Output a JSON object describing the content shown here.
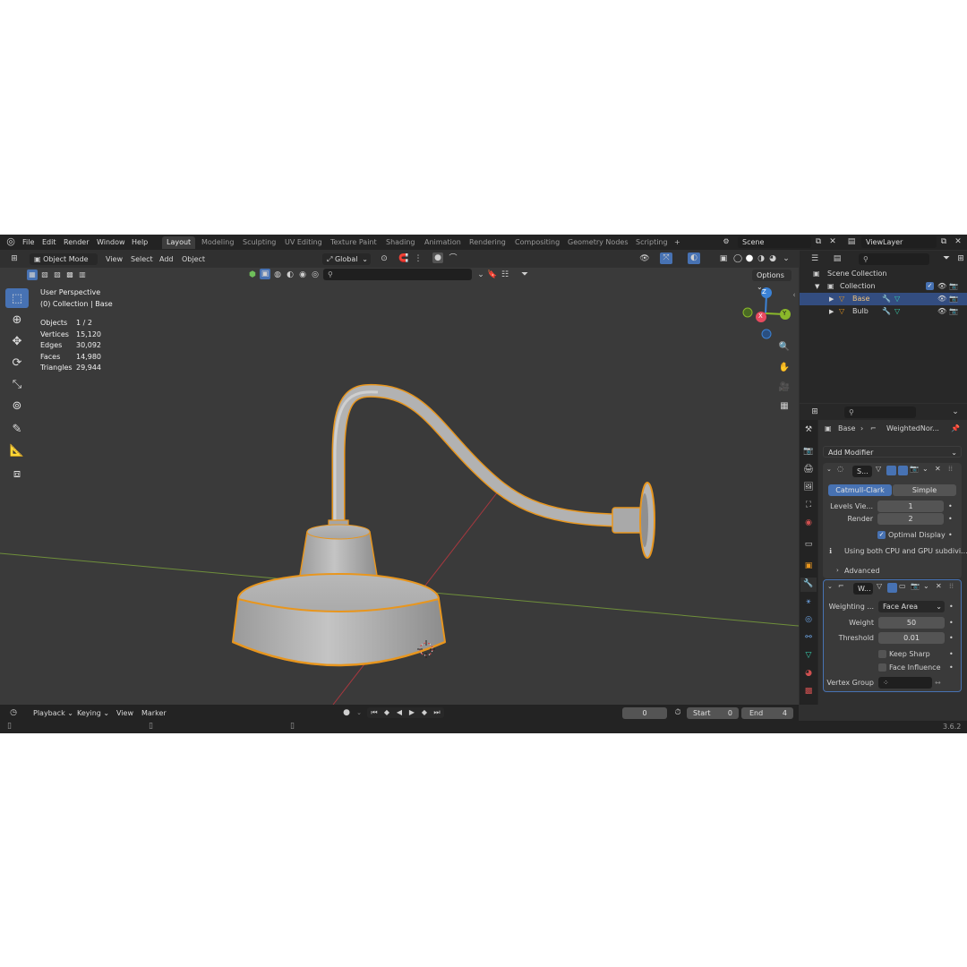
{
  "topbar": {
    "menus": [
      "File",
      "Edit",
      "Render",
      "Window",
      "Help"
    ],
    "workspace_tabs": [
      "Layout",
      "Modeling",
      "Sculpting",
      "UV Editing",
      "Texture Paint",
      "Shading",
      "Animation",
      "Rendering",
      "Compositing",
      "Geometry Nodes",
      "Scripting"
    ],
    "active_tab": "Layout",
    "add_tab": "+",
    "scene": "Scene",
    "view_layer": "ViewLayer"
  },
  "viewport_header": {
    "mode": "Object Mode",
    "menus": [
      "View",
      "Select",
      "Add",
      "Object"
    ],
    "transform_orientation": "Global",
    "options_label": "Options"
  },
  "viewport": {
    "view_name": "User Perspective",
    "collection_info": "(0) Collection | Base",
    "stats": [
      {
        "label": "Objects",
        "value": "1 / 2"
      },
      {
        "label": "Vertices",
        "value": "15,120"
      },
      {
        "label": "Edges",
        "value": "30,092"
      },
      {
        "label": "Faces",
        "value": "14,980"
      },
      {
        "label": "Triangles",
        "value": "29,944"
      }
    ],
    "gizmo_axes": {
      "x": "X",
      "y": "Y",
      "z": "Z"
    },
    "tools": [
      "select-box-tool",
      "cursor-tool",
      "move-tool",
      "rotate-tool",
      "scale-tool",
      "transform-tool",
      "annotate-tool",
      "measure-tool",
      "add-cube-tool"
    ]
  },
  "outliner": {
    "root": "Scene Collection",
    "collection": "Collection",
    "items": [
      {
        "name": "Base",
        "selected": true
      },
      {
        "name": "Bulb",
        "selected": false
      }
    ]
  },
  "properties": {
    "breadcrumb_object": "Base",
    "breadcrumb_modifier": "WeightedNor...",
    "add_modifier": "Add Modifier",
    "subsurf": {
      "name": "S...",
      "tabs": [
        "Catmull-Clark",
        "Simple"
      ],
      "active_tab": "Catmull-Clark",
      "levels_viewport_label": "Levels Vie...",
      "levels_viewport": "1",
      "render_label": "Render",
      "render": "2",
      "optimal_display_label": "Optimal Display",
      "optimal_display": true,
      "info": "Using both CPU and GPU subdivi...",
      "advanced_label": "Advanced"
    },
    "weighted_normal": {
      "name": "W...",
      "weighting_label": "Weighting ...",
      "weighting": "Face Area",
      "weight_label": "Weight",
      "weight": "50",
      "threshold_label": "Threshold",
      "threshold": "0.01",
      "keep_sharp_label": "Keep Sharp",
      "keep_sharp": false,
      "face_influence_label": "Face Influence",
      "face_influence": false,
      "vertex_group_label": "Vertex Group"
    }
  },
  "timeline": {
    "menus": [
      "Playback",
      "Keying",
      "View",
      "Marker"
    ],
    "current_frame": "0",
    "start_label": "Start",
    "start": "0",
    "end_label": "End",
    "end": "4"
  },
  "status": {
    "version": "3.6.2"
  },
  "colors": {
    "accent": "#4772b3",
    "selection_outline": "#e8961e",
    "x_axis": "#e84a5f",
    "y_axis": "#8ab82a",
    "z_axis": "#3b82d6"
  }
}
